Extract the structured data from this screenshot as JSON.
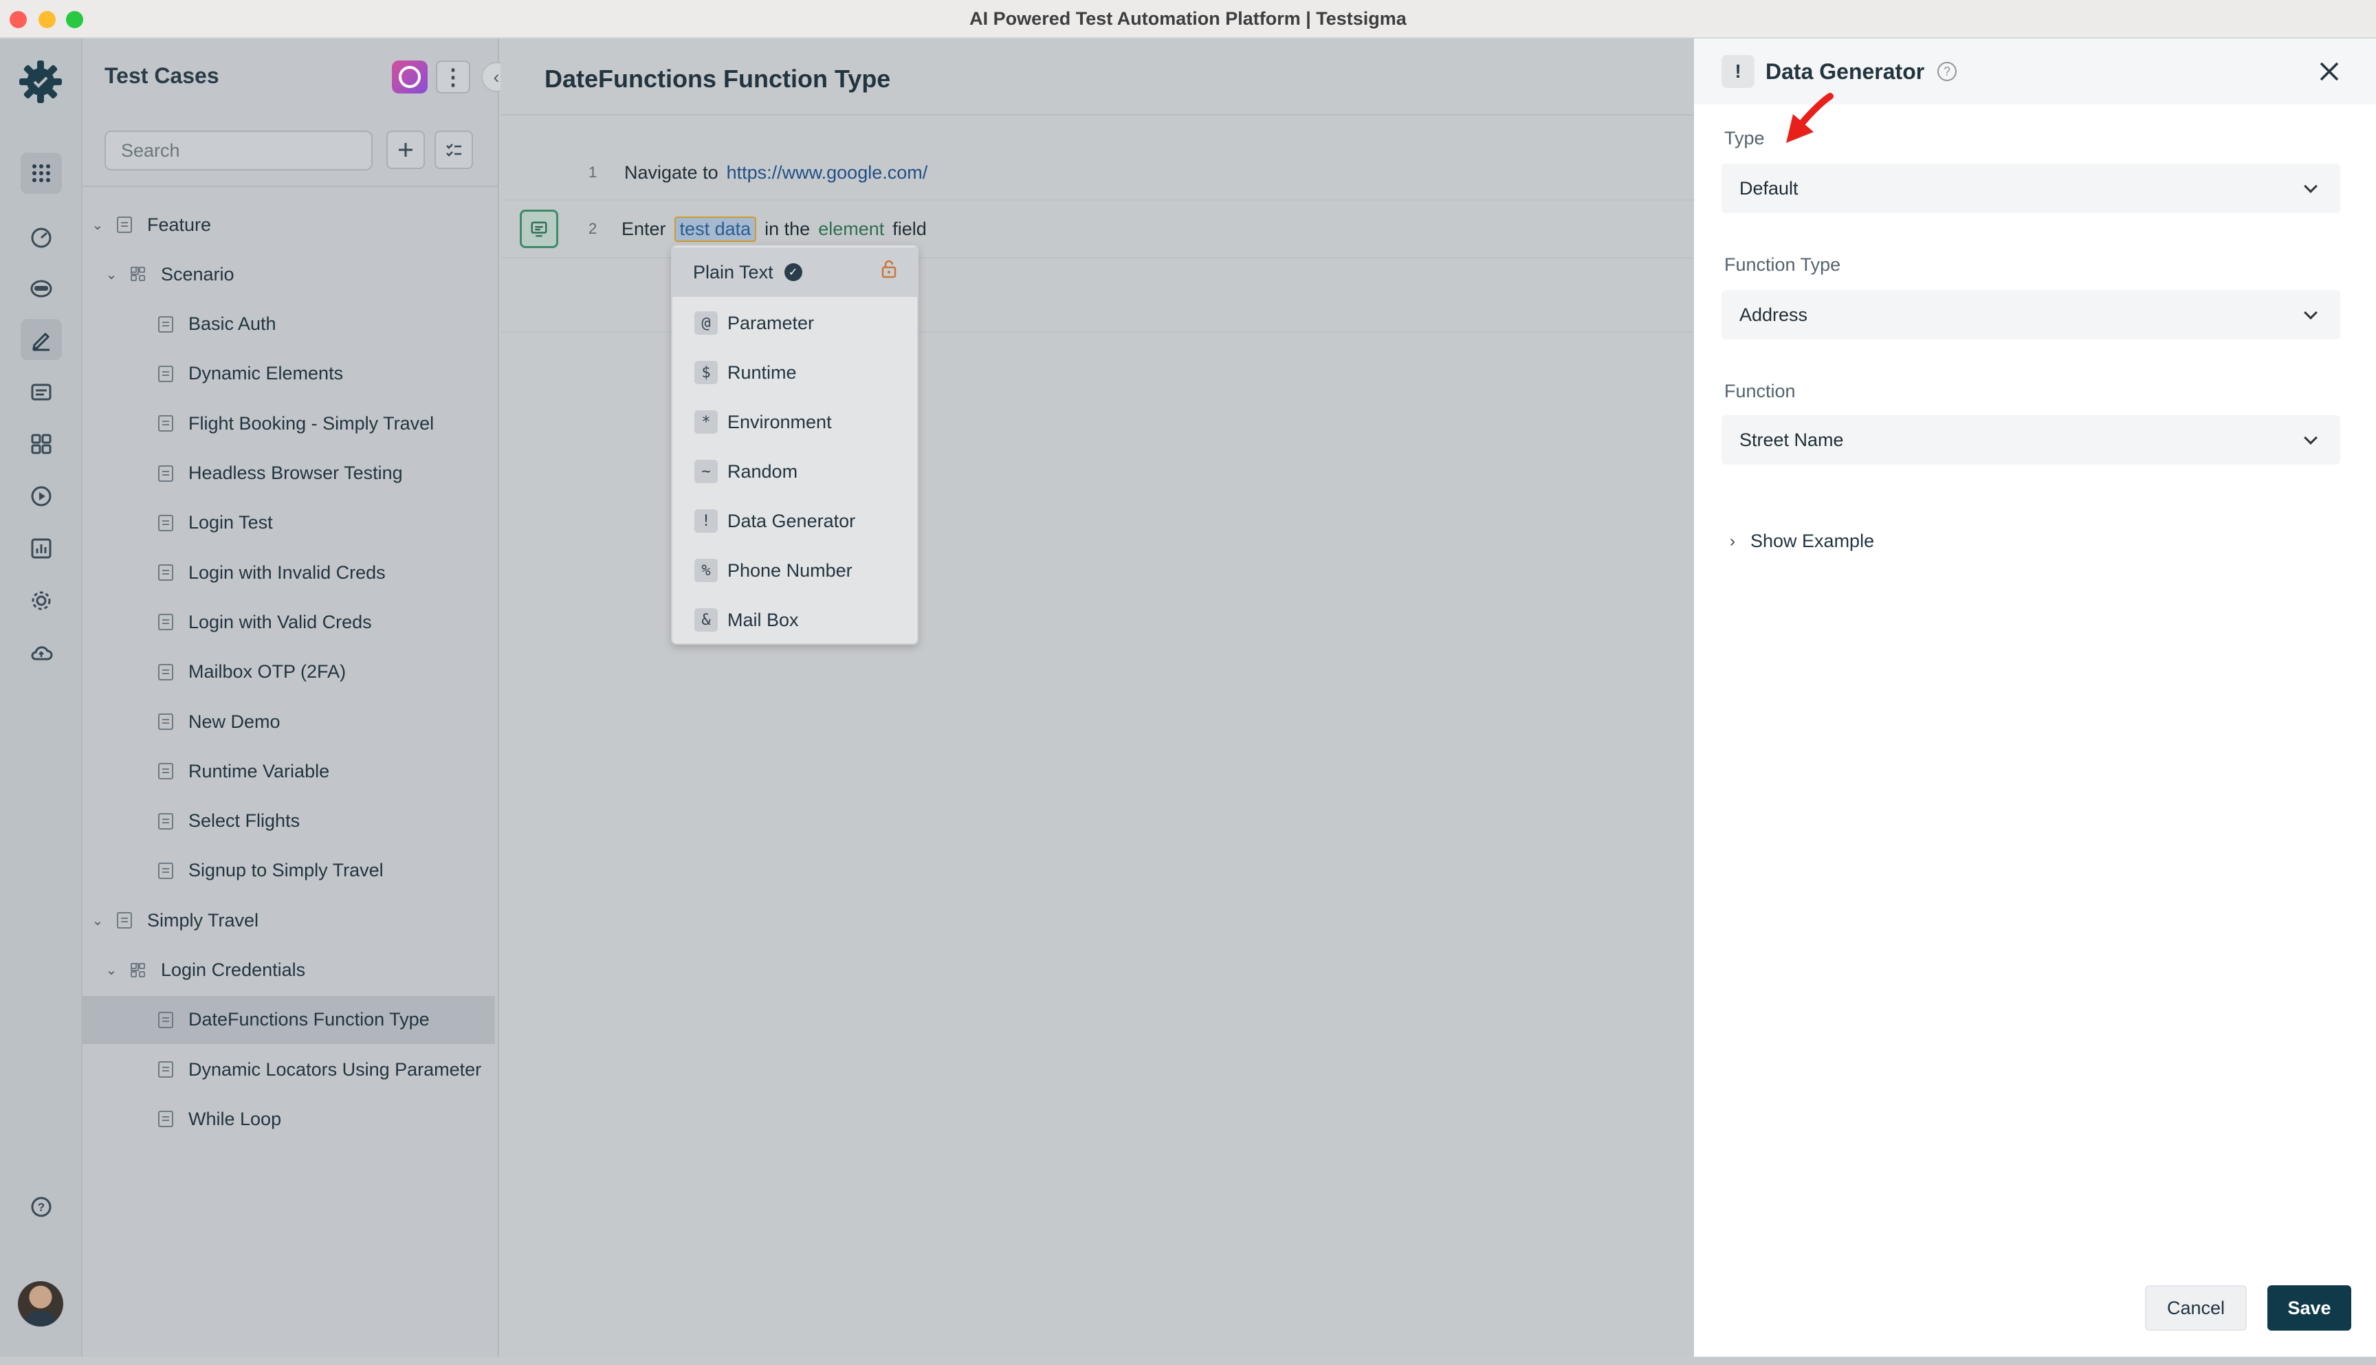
{
  "window": {
    "title": "AI Powered Test Automation Platform | Testsigma"
  },
  "rail": {
    "icons": [
      "testsigma-logo-icon",
      "apps-grid-icon",
      "dashboard-icon",
      "agent-icon",
      "edit-icon",
      "folder-icon",
      "modules-icon",
      "play-circle-icon",
      "reports-icon",
      "settings-icon",
      "cloud-icon",
      "help-icon",
      "user-avatar"
    ]
  },
  "test_cases": {
    "title": "Test Cases",
    "search_placeholder": "Search",
    "tree": [
      {
        "label": "Feature",
        "level": 0,
        "kind": "folder",
        "expanded": true
      },
      {
        "label": "Scenario",
        "level": 1,
        "kind": "group",
        "expanded": true
      },
      {
        "label": "Basic Auth",
        "level": 2,
        "kind": "case"
      },
      {
        "label": "Dynamic Elements",
        "level": 2,
        "kind": "case"
      },
      {
        "label": "Flight Booking - Simply Travel",
        "level": 2,
        "kind": "case"
      },
      {
        "label": "Headless Browser Testing",
        "level": 2,
        "kind": "case"
      },
      {
        "label": "Login Test",
        "level": 2,
        "kind": "case"
      },
      {
        "label": "Login with Invalid Creds",
        "level": 2,
        "kind": "case"
      },
      {
        "label": "Login with Valid Creds",
        "level": 2,
        "kind": "case"
      },
      {
        "label": "Mailbox OTP (2FA)",
        "level": 2,
        "kind": "case"
      },
      {
        "label": "New Demo",
        "level": 2,
        "kind": "case"
      },
      {
        "label": "Runtime Variable",
        "level": 2,
        "kind": "case"
      },
      {
        "label": "Select Flights",
        "level": 2,
        "kind": "case"
      },
      {
        "label": "Signup to Simply Travel",
        "level": 2,
        "kind": "case"
      },
      {
        "label": "Simply Travel",
        "level": 0,
        "kind": "folder",
        "expanded": true
      },
      {
        "label": "Login Credentials",
        "level": 1,
        "kind": "group",
        "expanded": true
      },
      {
        "label": "DateFunctions Function Type",
        "level": 2,
        "kind": "case",
        "selected": true
      },
      {
        "label": "Dynamic Locators Using Parameter",
        "level": 2,
        "kind": "case"
      },
      {
        "label": "While Loop",
        "level": 2,
        "kind": "case"
      }
    ]
  },
  "editor": {
    "title": "DateFunctions Function Type",
    "steps": [
      {
        "num": "1",
        "parts": [
          "Navigate to",
          "https://www.google.com/"
        ]
      },
      {
        "num": "2",
        "parts": [
          "Enter",
          "test data",
          "in the",
          "element",
          "field"
        ]
      }
    ],
    "dropdown": [
      {
        "sym": "",
        "label": "Plain Text"
      },
      {
        "sym": "@",
        "label": "Parameter"
      },
      {
        "sym": "$",
        "label": "Runtime"
      },
      {
        "sym": "*",
        "label": "Environment"
      },
      {
        "sym": "~",
        "label": "Random"
      },
      {
        "sym": "!",
        "label": "Data Generator"
      },
      {
        "sym": "%",
        "label": "Phone Number"
      },
      {
        "sym": "&",
        "label": "Mail Box"
      }
    ]
  },
  "drawer": {
    "badge": "!",
    "title": "Data Generator",
    "help": "?",
    "fields": [
      {
        "label": "Type",
        "value": "Default"
      },
      {
        "label": "Function Type",
        "value": "Address"
      },
      {
        "label": "Function",
        "value": "Street Name"
      }
    ],
    "show_example": "Show Example",
    "cancel": "Cancel",
    "save": "Save"
  },
  "colors": {
    "accent": "#0f3a4a",
    "annotation_arrow": "#e8201c",
    "selection": "#b1b6bc"
  }
}
